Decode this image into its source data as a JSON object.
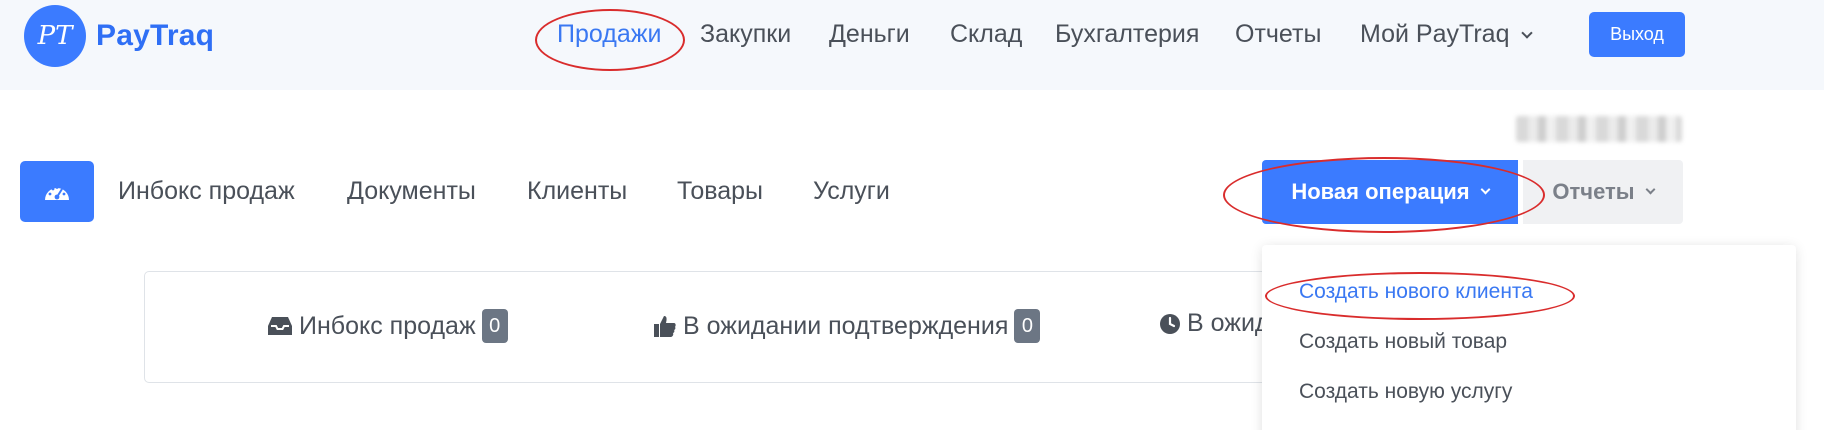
{
  "brand": {
    "logo_mark": "PT",
    "name": "PayTraq"
  },
  "topnav": {
    "items": [
      {
        "label": "Продажи",
        "active": true
      },
      {
        "label": "Закупки"
      },
      {
        "label": "Деньги"
      },
      {
        "label": "Склад"
      },
      {
        "label": "Бухгалтерия"
      },
      {
        "label": "Отчеты"
      },
      {
        "label": "Мой PayTraq",
        "has_dropdown": true
      }
    ],
    "logout_label": "Выход"
  },
  "subnav": {
    "dashboard_icon": "speedometer-icon",
    "items": [
      {
        "label": "Инбокс продаж"
      },
      {
        "label": "Документы"
      },
      {
        "label": "Клиенты"
      },
      {
        "label": "Товары"
      },
      {
        "label": "Услуги"
      }
    ],
    "new_operation_label": "Новая операция",
    "reports_label": "Отчеты"
  },
  "dropdown": {
    "items": [
      {
        "label": "Создать нового клиента",
        "highlighted": true
      },
      {
        "label": "Создать новый товар"
      },
      {
        "label": "Создать новую услугу"
      }
    ]
  },
  "status_card": {
    "items": [
      {
        "icon": "inbox-icon",
        "label": "Инбокс продаж",
        "count": "0"
      },
      {
        "icon": "thumbs-up-icon",
        "label": "В ожидании подтверждения",
        "count": "0"
      },
      {
        "icon": "clock-icon",
        "label": "В ожид"
      }
    ]
  },
  "colors": {
    "accent": "#3b7bff",
    "annotation": "#d92c2c",
    "badge": "#6c7684"
  }
}
